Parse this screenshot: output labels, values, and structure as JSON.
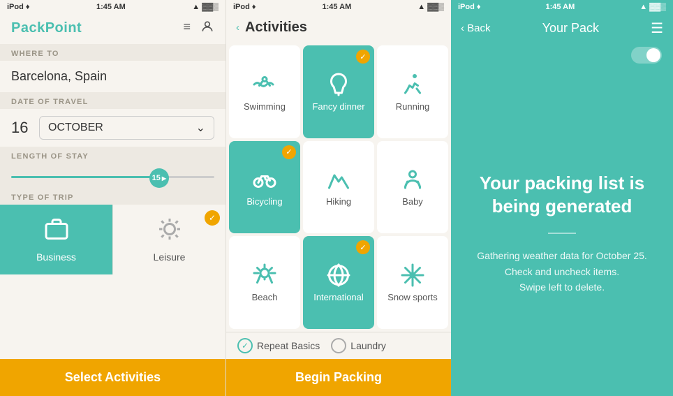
{
  "panel1": {
    "status": {
      "time": "1:45 AM",
      "device": "iPod ♦",
      "battery": "▓▓▓░",
      "signal": "▲"
    },
    "app_title": "PackPoint",
    "where_to_label": "WHERE TO",
    "destination": "Barcelona, Spain",
    "date_label": "DATE OF TRAVEL",
    "date_day": "16",
    "date_month": "OCTOBER",
    "length_label": "LENGTH OF STAY",
    "length_value": "15",
    "trip_type_label": "TYPE OF TRIP",
    "trip_types": [
      {
        "label": "Business",
        "active": true
      },
      {
        "label": "Leisure",
        "active": false
      }
    ],
    "select_activities_label": "Select Activities"
  },
  "panel2": {
    "status": {
      "time": "1:45 AM",
      "device": "iPod ♦",
      "battery": "▓▓▓░"
    },
    "back_label": "‹",
    "title": "Activities",
    "activities": [
      {
        "label": "Swimming",
        "selected": false,
        "icon": "swimming"
      },
      {
        "label": "Fancy dinner",
        "selected": true,
        "icon": "dinner"
      },
      {
        "label": "Running",
        "selected": false,
        "icon": "running"
      },
      {
        "label": "Bicycling",
        "selected": true,
        "icon": "bicycle"
      },
      {
        "label": "Hiking",
        "selected": false,
        "icon": "hiking"
      },
      {
        "label": "Baby",
        "selected": false,
        "icon": "baby"
      },
      {
        "label": "Beach",
        "selected": false,
        "icon": "beach"
      },
      {
        "label": "International",
        "selected": true,
        "icon": "international"
      },
      {
        "label": "Snow sports",
        "selected": false,
        "icon": "snow"
      }
    ],
    "repeat_basics_label": "Repeat Basics",
    "laundry_label": "Laundry",
    "begin_packing_label": "Begin Packing"
  },
  "panel3": {
    "status": {
      "time": "1:45 AM",
      "device": "iPod ♦",
      "battery": "▓▓▓░"
    },
    "back_label": "‹ Back",
    "title": "Your Pack",
    "main_text": "Your packing list is being generated",
    "sub_text": "Gathering weather data for October 25.\nCheck and uncheck items.\nSwipe left to delete."
  }
}
